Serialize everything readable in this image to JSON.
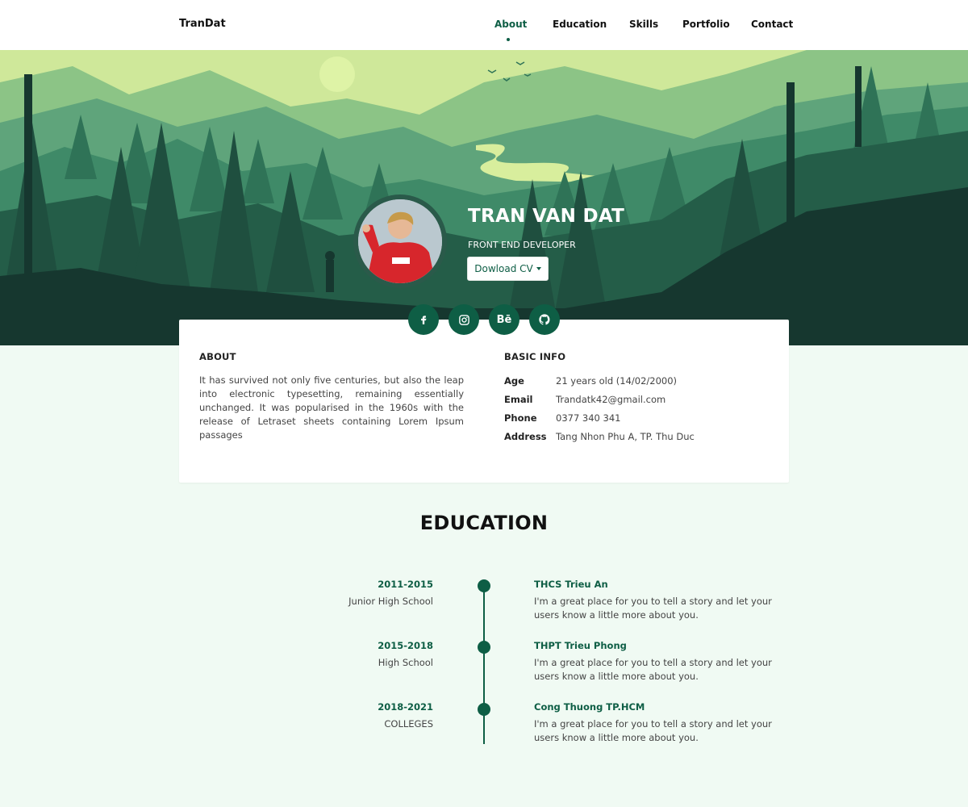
{
  "nav": {
    "brand": "TranDat",
    "links": [
      {
        "label": "About",
        "active": true
      },
      {
        "label": "Education",
        "active": false
      },
      {
        "label": "Skills",
        "active": false
      },
      {
        "label": "Portfolio",
        "active": false
      },
      {
        "label": "Contact",
        "active": false
      }
    ]
  },
  "hero": {
    "name": "TRAN VAN DAT",
    "role": "FRONT END DEVELOPER",
    "cv_button": "Dowload CV"
  },
  "socials": [
    {
      "icon": "facebook-icon",
      "glyph": "f"
    },
    {
      "icon": "instagram-icon",
      "glyph": ""
    },
    {
      "icon": "behance-icon",
      "glyph": "Bē"
    },
    {
      "icon": "github-icon",
      "glyph": ""
    }
  ],
  "about": {
    "title": "ABOUT",
    "text": "It has survived not only five centuries, but also the leap into electronic typesetting, remaining essentially unchanged. It was popularised in the 1960s with the release of Letraset sheets containing Lorem Ipsum passages"
  },
  "basic_info": {
    "title": "BASIC INFO",
    "rows": [
      {
        "label": "Age",
        "value": "21 years old (14/02/2000)"
      },
      {
        "label": "Email",
        "value": "Trandatk42@gmail.com"
      },
      {
        "label": "Phone",
        "value": "0377 340 341"
      },
      {
        "label": "Address",
        "value": "Tang Nhon Phu A, TP. Thu Duc"
      }
    ]
  },
  "education": {
    "title": "EDUCATION",
    "items": [
      {
        "years": "2011-2015",
        "level": "Junior High School",
        "school": "THCS Trieu An",
        "desc": "I'm a great place for you to tell a story and let your users know a little more about you."
      },
      {
        "years": "2015-2018",
        "level": "High School",
        "school": "THPT Trieu Phong",
        "desc": "I'm a great place for you to tell a story and let your users know a little more about you."
      },
      {
        "years": "2018-2021",
        "level": "COLLEGES",
        "school": "Cong Thuong TP.HCM",
        "desc": "I'm a great place for you to tell a story and let your users know a little more about you."
      }
    ]
  },
  "colors": {
    "accent": "#0e5e45",
    "page_bg": "#f0faf3"
  }
}
